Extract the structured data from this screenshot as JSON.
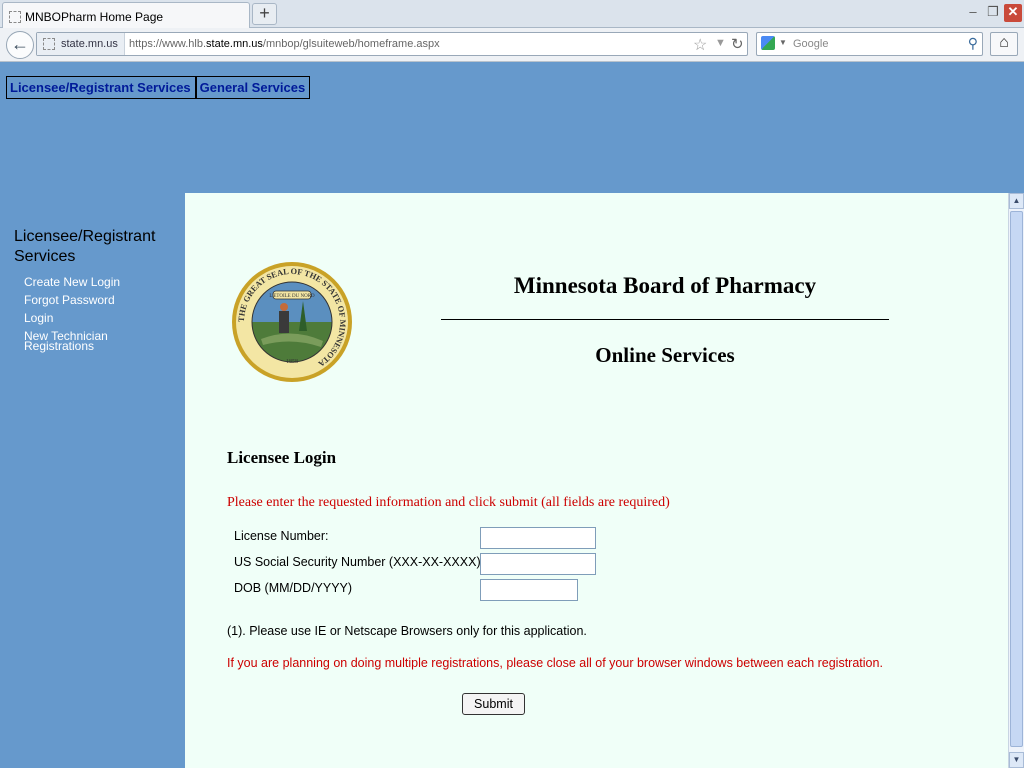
{
  "browser": {
    "tab_title": "MNBOPharm Home Page",
    "new_tab_label": "+",
    "site_identity": "state.mn.us",
    "url_prefix": "https://www.hlb.",
    "url_domain": "state.mn.us",
    "url_path": "/mnbop/glsuiteweb/homeframe.aspx",
    "search_placeholder": "Google"
  },
  "topmenu": {
    "items": [
      {
        "label": "Licensee/Registrant Services"
      },
      {
        "label": "General Services"
      }
    ]
  },
  "sidebar": {
    "title": "Licensee/Registrant Services",
    "links": [
      {
        "label": "Create New Login"
      },
      {
        "label": "Forgot Password"
      },
      {
        "label": "Login"
      },
      {
        "label": "New Technician Registrations"
      }
    ]
  },
  "main": {
    "board_title": "Minnesota Board of Pharmacy",
    "subtitle": "Online Services",
    "seal_text": "THE GREAT SEAL OF THE STATE OF MINNESOTA",
    "seal_motto": "L'ETOILE DU NORD",
    "seal_year": "1858",
    "login_heading": "Licensee Login",
    "instructions": "Please enter the requested information and click submit (all fields are required)",
    "fields": [
      {
        "label": "License Number:",
        "value": ""
      },
      {
        "label": "US Social Security Number (XXX-XX-XXXX)",
        "value": ""
      },
      {
        "label": "DOB (MM/DD/YYYY)",
        "value": ""
      }
    ],
    "note1": "(1). Please use IE or Netscape Browsers only for this application.",
    "note2": "If you are planning on doing multiple registrations, please close all of your browser windows between each registration.",
    "submit_label": "Submit"
  },
  "colors": {
    "page_background": "#6699cc",
    "content_background": "#f0fff8",
    "menu_text": "#001a99",
    "warning_text": "#cc0000"
  }
}
